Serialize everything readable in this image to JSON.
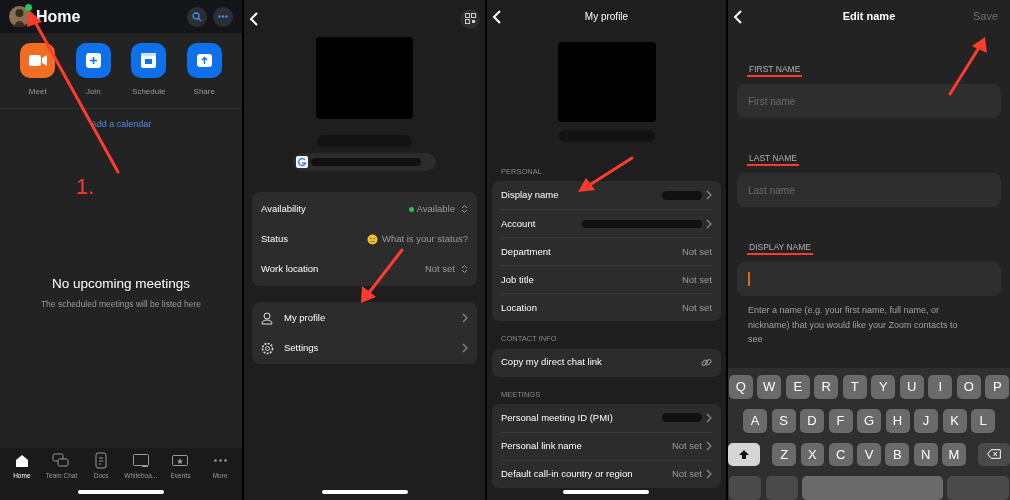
{
  "home": {
    "title": "Home",
    "actions": [
      {
        "label": "Meet",
        "color": "#f26d21"
      },
      {
        "label": "Join",
        "color": "#0e71eb"
      },
      {
        "label": "Schedule",
        "color": "#0e71eb"
      },
      {
        "label": "Share",
        "color": "#0e71eb"
      }
    ],
    "calendar_link": "Add a calendar",
    "step_label": "1.",
    "empty_title": "No upcoming meetings",
    "empty_subtitle": "The scheduled meetings will be listed here",
    "nav": [
      {
        "label": "Home",
        "selected": true
      },
      {
        "label": "Team Chat",
        "selected": false
      },
      {
        "label": "Docs",
        "selected": false
      },
      {
        "label": "Whiteboa...",
        "selected": false
      },
      {
        "label": "Events",
        "selected": false
      },
      {
        "label": "More",
        "selected": false
      }
    ]
  },
  "menu": {
    "status_rows": [
      {
        "label": "Availability",
        "value": "Available",
        "kind": "available"
      },
      {
        "label": "Status",
        "value": "What is your status?",
        "kind": "status"
      },
      {
        "label": "Work location",
        "value": "Not set",
        "kind": "picker"
      }
    ],
    "links": [
      {
        "label": "My profile"
      },
      {
        "label": "Settings"
      }
    ]
  },
  "profile": {
    "title": "My profile",
    "sections": [
      {
        "heading": "PERSONAL",
        "rows": [
          {
            "label": "Display name",
            "kind": "redacted",
            "chevron": true
          },
          {
            "label": "Account",
            "kind": "redacted",
            "chevron": true
          },
          {
            "label": "Department",
            "kind": "value",
            "value": "Not set",
            "chevron": false
          },
          {
            "label": "Job title",
            "kind": "value",
            "value": "Not set",
            "chevron": false
          },
          {
            "label": "Location",
            "kind": "value",
            "value": "Not set",
            "chevron": false
          }
        ]
      },
      {
        "heading": "CONTACT INFO",
        "rows": [
          {
            "label": "Copy my direct chat link",
            "kind": "link",
            "chevron": false
          }
        ]
      },
      {
        "heading": "MEETINGS",
        "rows": [
          {
            "label": "Personal meeting ID (PMI)",
            "kind": "redacted",
            "chevron": true
          },
          {
            "label": "Personal link name",
            "kind": "value",
            "value": "Not set",
            "chevron": true
          },
          {
            "label": "Default call-in country or region",
            "kind": "value",
            "value": "Not set",
            "chevron": true
          }
        ]
      }
    ]
  },
  "edit_name": {
    "title": "Edit name",
    "save": "Save",
    "save_enabled": false,
    "fields": [
      {
        "label": "FIRST NAME",
        "placeholder": "First name",
        "focused": false
      },
      {
        "label": "LAST NAME",
        "placeholder": "Last name",
        "focused": false
      },
      {
        "label": "DISPLAY NAME",
        "focused": true
      }
    ],
    "hint": "Enter a name (e.g. your first name, full name, or nickname) that you would like your Zoom contacts to see",
    "keyboard": [
      [
        "Q",
        "W",
        "E",
        "R",
        "T",
        "Y",
        "U",
        "I",
        "O",
        "P"
      ],
      [
        "A",
        "S",
        "D",
        "F",
        "G",
        "H",
        "J",
        "K",
        "L"
      ],
      [
        "Z",
        "X",
        "C",
        "V",
        "B",
        "N",
        "M"
      ]
    ]
  }
}
